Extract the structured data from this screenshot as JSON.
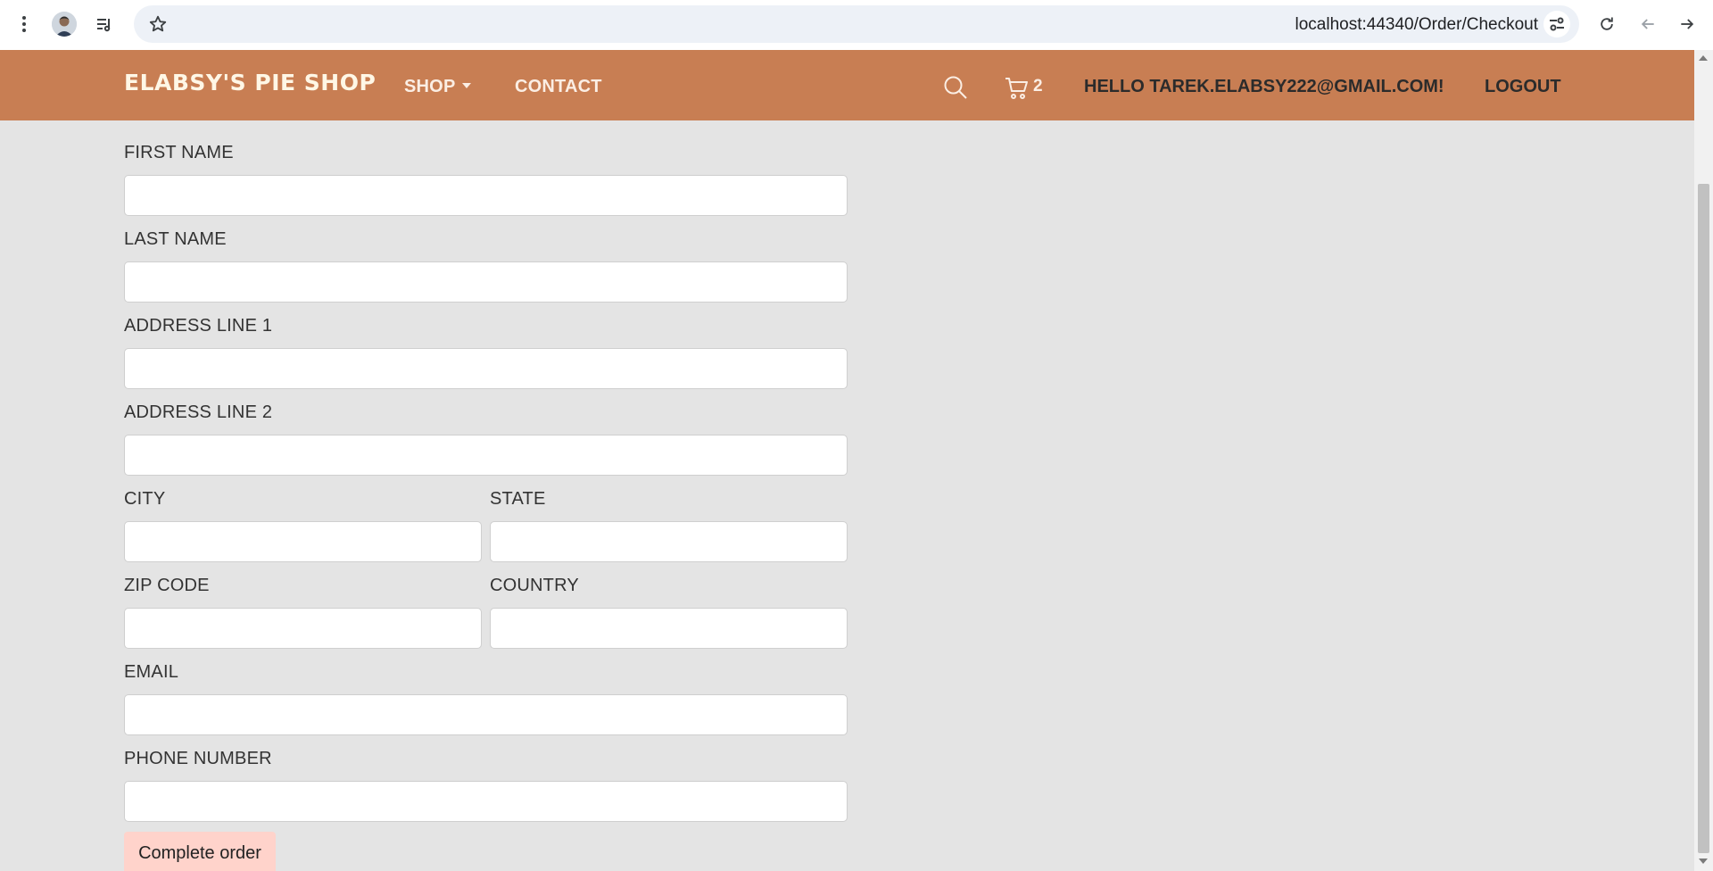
{
  "browser": {
    "url": "localhost:44340/Order/Checkout",
    "icons": [
      "more-vert-icon",
      "avatar",
      "media-queue-icon",
      "star-icon",
      "site-settings-icon",
      "reload-icon",
      "back-icon",
      "forward-icon"
    ]
  },
  "navbar": {
    "brand": "ELABSY'S PIE SHOP",
    "shop": "SHOP",
    "contact": "CONTACT",
    "cart_count": "2",
    "greeting": "HELLO TAREK.ELABSY222@GMAIL.COM!",
    "logout": "LOGOUT",
    "bg_color": "#c87e53"
  },
  "form": {
    "first_name": {
      "label": "FIRST NAME",
      "value": ""
    },
    "last_name": {
      "label": "LAST NAME",
      "value": ""
    },
    "address1": {
      "label": "ADDRESS LINE 1",
      "value": ""
    },
    "address2": {
      "label": "ADDRESS LINE 2",
      "value": ""
    },
    "city": {
      "label": "CITY",
      "value": ""
    },
    "state": {
      "label": "STATE",
      "value": ""
    },
    "zip": {
      "label": "ZIP CODE",
      "value": ""
    },
    "country": {
      "label": "COUNTRY",
      "value": ""
    },
    "email": {
      "label": "EMAIL",
      "value": ""
    },
    "phone": {
      "label": "PHONE NUMBER",
      "value": ""
    },
    "submit": "Complete order",
    "submit_color": "#ffd3cb"
  }
}
